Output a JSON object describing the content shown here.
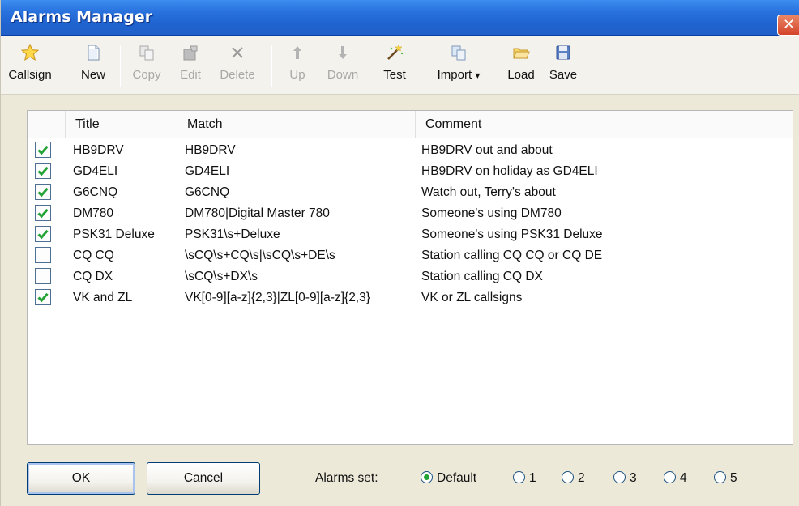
{
  "window": {
    "title": "Alarms Manager",
    "close_glyph": "✕"
  },
  "toolbar": {
    "callsign": "Callsign",
    "new": "New",
    "copy": "Copy",
    "edit": "Edit",
    "delete": "Delete",
    "up": "Up",
    "down": "Down",
    "test": "Test",
    "import": "Import",
    "import_arrow": "▾",
    "load": "Load",
    "save": "Save"
  },
  "list": {
    "columns": [
      "Title",
      "Match",
      "Comment"
    ],
    "rows": [
      {
        "checked": true,
        "title": "HB9DRV",
        "match": "HB9DRV",
        "comment": "HB9DRV out and about"
      },
      {
        "checked": true,
        "title": "GD4ELI",
        "match": "GD4ELI",
        "comment": "HB9DRV on holiday as GD4ELI"
      },
      {
        "checked": true,
        "title": "G6CNQ",
        "match": "G6CNQ",
        "comment": "Watch out, Terry's about"
      },
      {
        "checked": true,
        "title": "DM780",
        "match": "DM780|Digital Master 780",
        "comment": "Someone's using DM780"
      },
      {
        "checked": true,
        "title": "PSK31 Deluxe",
        "match": "PSK31\\s+Deluxe",
        "comment": "Someone's using PSK31 Deluxe"
      },
      {
        "checked": false,
        "title": "CQ CQ",
        "match": "\\sCQ\\s+CQ\\s|\\sCQ\\s+DE\\s",
        "comment": "Station calling CQ CQ or CQ DE"
      },
      {
        "checked": false,
        "title": "CQ DX",
        "match": "\\sCQ\\s+DX\\s",
        "comment": "Station calling CQ DX"
      },
      {
        "checked": true,
        "title": "VK and ZL",
        "match": "VK[0-9][a-z]{2,3}|ZL[0-9][a-z]{2,3}",
        "comment": "VK or ZL callsigns"
      }
    ]
  },
  "footer": {
    "ok": "OK",
    "cancel": "Cancel",
    "alarms_set_label": "Alarms set:",
    "alarm_sets": [
      "Default",
      "1",
      "2",
      "3",
      "4",
      "5"
    ],
    "selected_set": "Default"
  },
  "colors": {
    "titlebar": "#2a74e0",
    "check": "#23a335"
  }
}
